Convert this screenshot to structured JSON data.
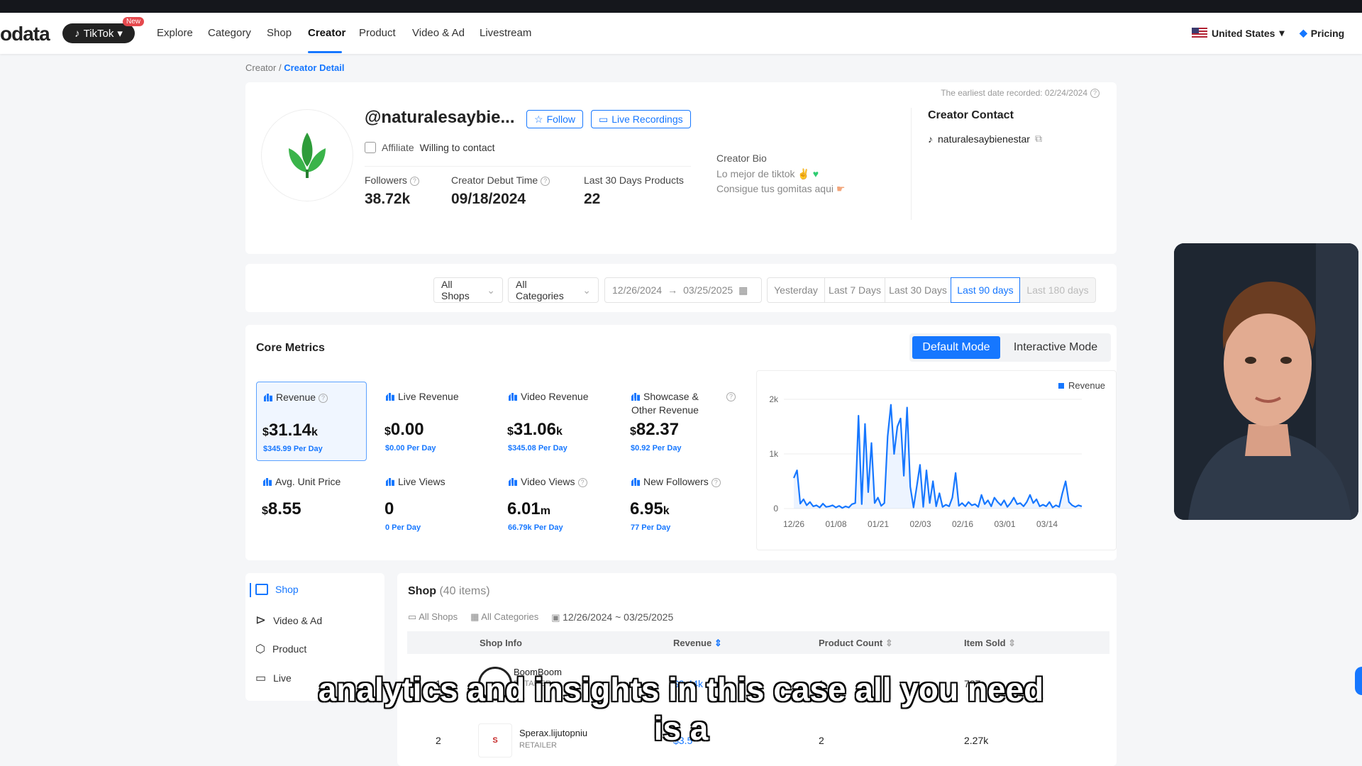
{
  "nav": {
    "logo": "odata",
    "platform": "TikTok",
    "new_badge": "New",
    "items": [
      "Explore",
      "Category",
      "Shop",
      "Creator",
      "Product",
      "Video & Ad",
      "Livestream"
    ],
    "active": "Creator",
    "region": "United States",
    "pricing": "Pricing"
  },
  "breadcrumb": {
    "parent": "Creator",
    "separator": "/",
    "current": "Creator Detail"
  },
  "profile": {
    "handle": "@naturalesaybie...",
    "follow_label": "Follow",
    "live_recordings_label": "Live Recordings",
    "affiliate_label": "Affiliate",
    "contact_status": "Willing to contact",
    "stats": [
      {
        "label": "Followers",
        "value": "38.72k"
      },
      {
        "label": "Creator Debut Time",
        "value": "09/18/2024"
      },
      {
        "label": "Last 30 Days Products",
        "value": "22"
      }
    ],
    "bio_title": "Creator Bio",
    "bio_lines": [
      "Lo mejor de tiktok",
      "Consigue tus gomitas aqui"
    ],
    "earliest_date": "The earliest date recorded: 02/24/2024",
    "contact_title": "Creator Contact",
    "contact_handle": "naturalesaybienestar"
  },
  "filters": {
    "shops": "All Shops",
    "categories": "All Categories",
    "date_start": "12/26/2024",
    "date_arrow": "→",
    "date_end": "03/25/2025",
    "ranges": [
      "Yesterday",
      "Last 7 Days",
      "Last 30 Days",
      "Last 90 days",
      "Last 180 days"
    ],
    "active_range": "Last 90 days"
  },
  "core_metrics": {
    "title": "Core Metrics",
    "modes": [
      "Default Mode",
      "Interactive Mode"
    ],
    "active_mode": "Default Mode",
    "metrics": [
      {
        "label": "Revenue",
        "prefix": "$",
        "value": "31.14",
        "unit": "k",
        "sub": "$345.99 Per Day"
      },
      {
        "label": "Live Revenue",
        "prefix": "$",
        "value": "0.00",
        "unit": "",
        "sub": "$0.00 Per Day"
      },
      {
        "label": "Video Revenue",
        "prefix": "$",
        "value": "31.06",
        "unit": "k",
        "sub": "$345.08 Per Day"
      },
      {
        "label": "Showcase & Other Revenue",
        "prefix": "$",
        "value": "82.37",
        "unit": "",
        "sub": "$0.92 Per Day"
      },
      {
        "label": "Avg. Unit Price",
        "prefix": "$",
        "value": "8.55",
        "unit": "",
        "sub": ""
      },
      {
        "label": "Live Views",
        "prefix": "",
        "value": "0",
        "unit": "",
        "sub": "0 Per Day"
      },
      {
        "label": "Video Views",
        "prefix": "",
        "value": "6.01",
        "unit": "m",
        "sub": "66.79k Per Day"
      },
      {
        "label": "New Followers",
        "prefix": "",
        "value": "6.95",
        "unit": "k",
        "sub": "77 Per Day"
      }
    ]
  },
  "chart_data": {
    "type": "line",
    "legend": "Revenue",
    "color": "#1677ff",
    "x_ticks": [
      "12/26",
      "01/08",
      "01/21",
      "02/03",
      "02/16",
      "03/01",
      "03/14"
    ],
    "y_ticks": [
      "0",
      "1k",
      "2k"
    ],
    "ylim": [
      0,
      2000
    ],
    "series": [
      {
        "name": "Revenue",
        "values": [
          560,
          700,
          90,
          170,
          60,
          120,
          40,
          60,
          20,
          90,
          30,
          40,
          60,
          20,
          50,
          10,
          40,
          20,
          80,
          100,
          1700,
          80,
          1550,
          300,
          1200,
          100,
          200,
          50,
          100,
          1320,
          1900,
          1000,
          1500,
          1650,
          600,
          1850,
          400,
          20,
          400,
          800,
          30,
          700,
          100,
          500,
          40,
          280,
          30,
          70,
          40,
          200,
          650,
          50,
          100,
          40,
          120,
          60,
          80,
          30,
          250,
          80,
          150,
          40,
          200,
          120,
          60,
          150,
          30,
          100,
          200,
          80,
          100,
          40,
          120,
          250,
          100,
          170,
          40,
          70,
          40,
          120,
          20,
          60,
          30,
          280,
          500,
          120,
          60,
          30,
          60,
          40
        ]
      }
    ]
  },
  "detail": {
    "tabs": [
      "Shop",
      "Video & Ad",
      "Product",
      "Live"
    ],
    "active_tab": "Shop",
    "title": "Shop",
    "count": "(40 items)",
    "filter_shops": "All Shops",
    "filter_categories": "All Categories",
    "date_range": "12/26/2024 ~ 03/25/2025",
    "columns": [
      "Shop Info",
      "Revenue",
      "Product Count",
      "Item Sold"
    ],
    "rows": [
      {
        "rank": "1",
        "name": "BoomBoom",
        "type": "RETAILER",
        "revenue": "$9.44k",
        "products": "1",
        "sold": "787"
      },
      {
        "rank": "2",
        "name": "Sperax.lijutopniu",
        "type": "RETAILER",
        "revenue": "$3.5",
        "products": "2",
        "sold": "2.27k"
      }
    ]
  },
  "subtitle": {
    "line1": "analytics and insights in this case all you need",
    "line2": "is a"
  }
}
